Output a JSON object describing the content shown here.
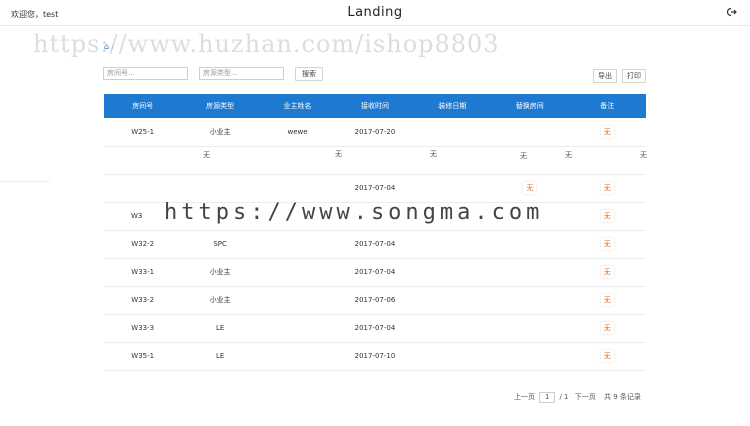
{
  "header": {
    "welcome": "欢迎您，test",
    "title": "Landing",
    "logout_icon": "logout-icon"
  },
  "breadcrumb": {
    "home_icon": "home-icon",
    "path": "/  "
  },
  "watermarks": {
    "top": "https://www.huzhan.com/ishop8803",
    "middle": "https://www.songma.com"
  },
  "toolbar": {
    "room_no_placeholder": "房间号...",
    "room_type_placeholder": "房源类型...",
    "search_label": "搜索",
    "export_label": "导出",
    "print_label": "打印"
  },
  "table": {
    "columns": [
      "房间号",
      "房源类型",
      "业主姓名",
      "接收时间",
      "装修日期",
      "替换房间",
      "备注"
    ],
    "rows": [
      [
        "W25-1",
        "小业主",
        "wewe",
        "2017-07-20",
        "",
        "",
        "无"
      ],
      [
        "",
        "",
        "",
        "",
        "",
        "",
        ""
      ],
      [
        "",
        "",
        "",
        "2017-07-04",
        "",
        "无",
        "无"
      ],
      [
        "W3",
        "",
        "",
        "",
        "",
        "",
        "无"
      ],
      [
        "W32-2",
        "SPC",
        "",
        "2017-07-04",
        "",
        "",
        "无"
      ],
      [
        "W33-1",
        "小业主",
        "",
        "2017-07-04",
        "",
        "",
        "无"
      ],
      [
        "W33-2",
        "小业主",
        "",
        "2017-07-06",
        "",
        "",
        "无"
      ],
      [
        "W33-3",
        "LE",
        "",
        "2017-07-04",
        "",
        "",
        "无"
      ],
      [
        "W35-1",
        "LE",
        "",
        "2017-07-10",
        "",
        "",
        "无"
      ]
    ]
  },
  "glitch_fragments": [
    "无",
    "无",
    "无",
    "无",
    "无",
    "无"
  ],
  "pagination": {
    "prev": "上一页",
    "current": "1",
    "total": "/ 1",
    "next": "下一页",
    "records": "共 9 条记录"
  }
}
